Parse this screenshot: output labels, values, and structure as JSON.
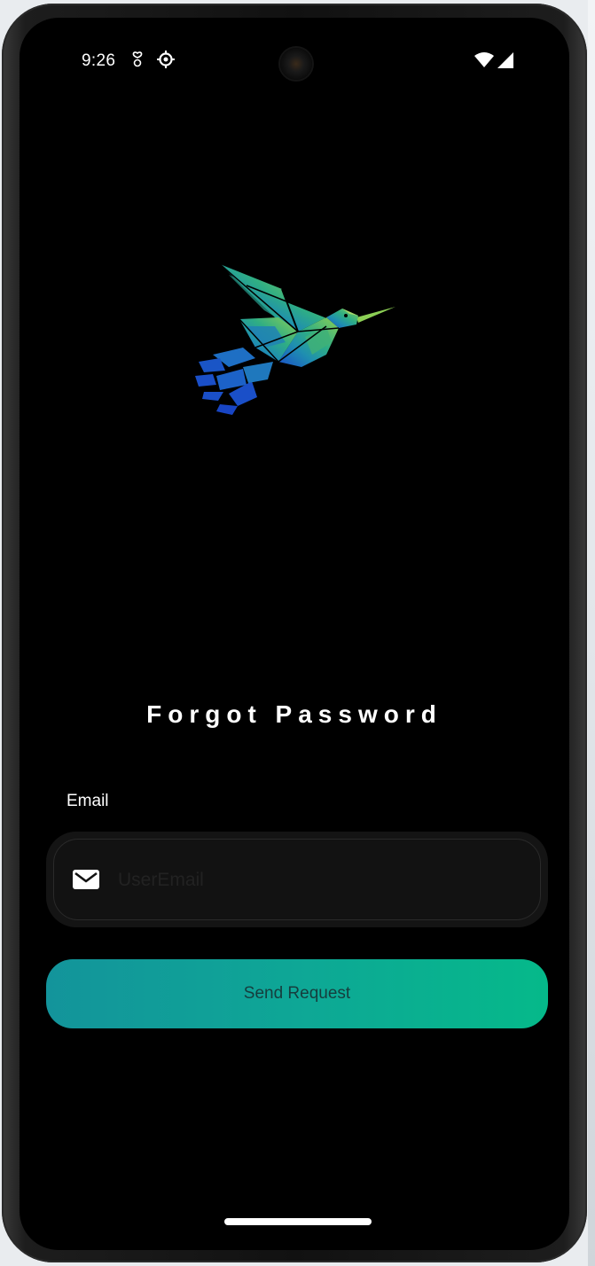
{
  "status_bar": {
    "time": "9:26",
    "icons": [
      "heart-notification-icon",
      "settings-gear-icon",
      "wifi-icon",
      "cellular-signal-icon"
    ]
  },
  "app": {
    "logo_icon": "hummingbird-logo-icon",
    "title": "Forgot Password",
    "email_label": "Email",
    "email_placeholder": "UserEmail",
    "email_value": "",
    "send_button_label": "Send Request"
  },
  "colors": {
    "background": "#000000",
    "button_gradient_start": "#13949b",
    "button_gradient_end": "#05b98a",
    "input_background": "#141414",
    "text": "#ffffff"
  }
}
